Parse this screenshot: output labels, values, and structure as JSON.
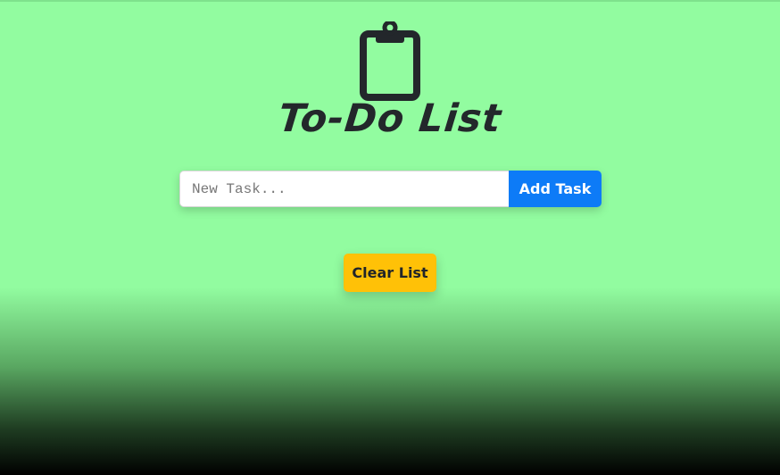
{
  "app": {
    "title": "To-Do List",
    "logo_icon": "clipboard-icon"
  },
  "task_form": {
    "input_value": "",
    "placeholder": "New Task...",
    "add_label": "Add Task"
  },
  "actions": {
    "clear_label": "Clear List"
  },
  "tasks": [],
  "colors": {
    "background_top": "#92fca0",
    "background_bottom": "#000000",
    "text_dark": "#23272b",
    "add_button": "#0d7bf7",
    "clear_button": "#ffc107"
  }
}
